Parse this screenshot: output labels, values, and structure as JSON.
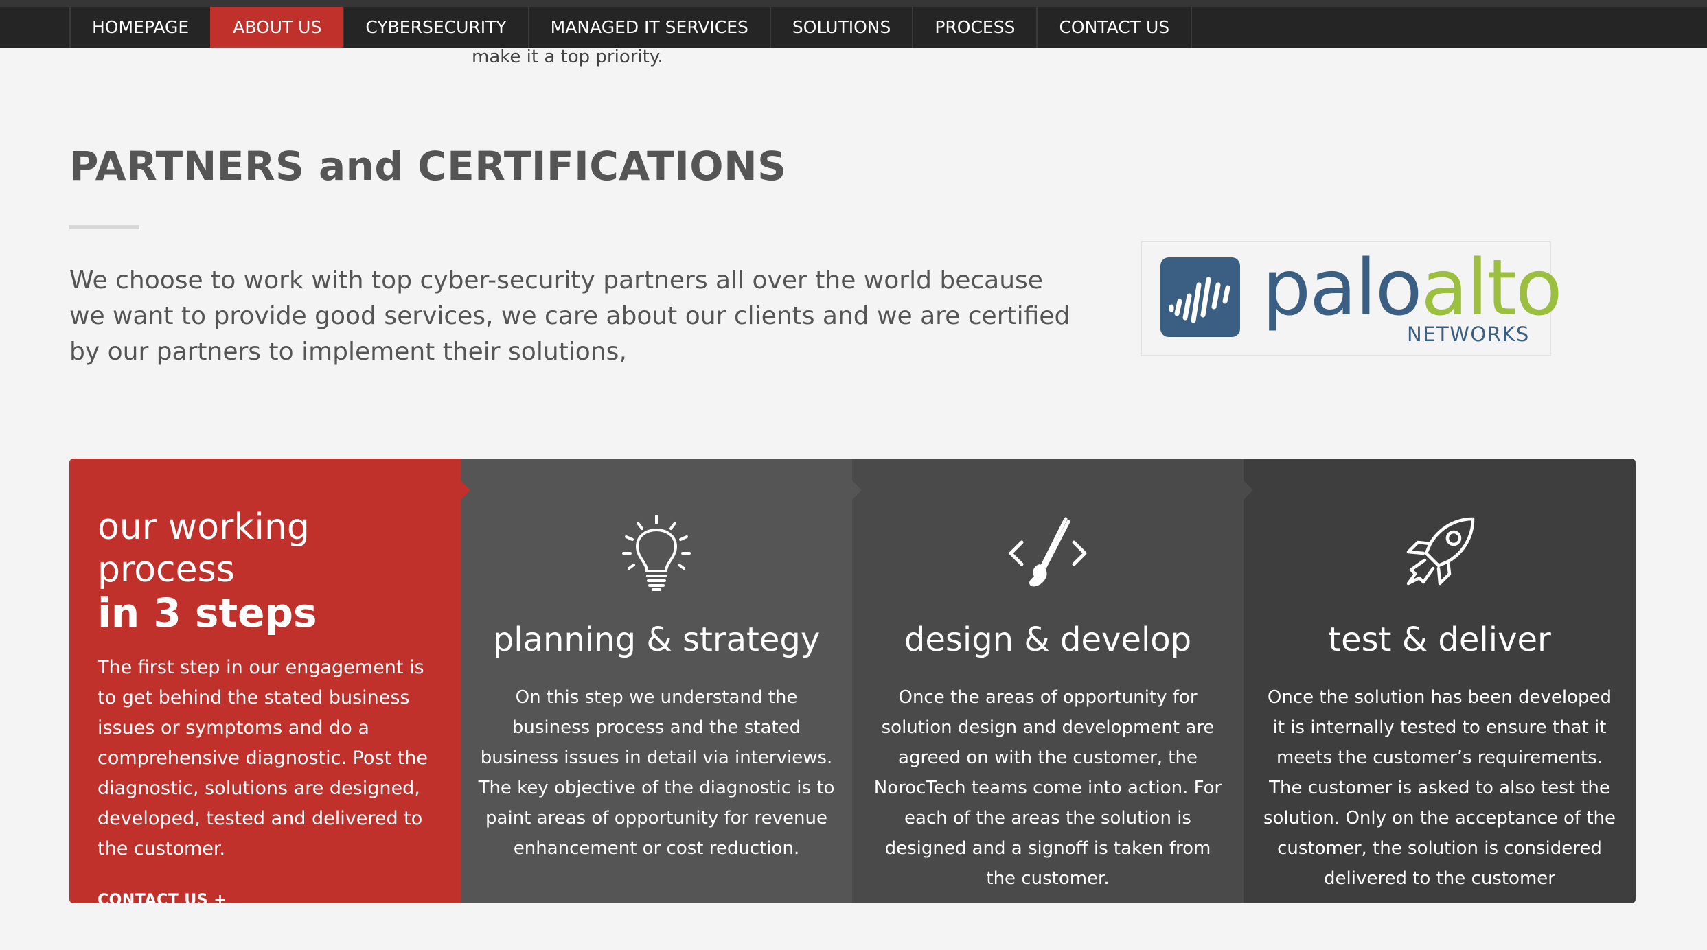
{
  "nav": {
    "items": [
      {
        "label": "HOMEPAGE"
      },
      {
        "label": "ABOUT US"
      },
      {
        "label": "CYBERSECURITY"
      },
      {
        "label": "MANAGED IT SERVICES"
      },
      {
        "label": "SOLUTIONS"
      },
      {
        "label": "PROCESS"
      },
      {
        "label": "CONTACT US"
      }
    ],
    "active": "ABOUT US"
  },
  "previous_section": {
    "tail_text": "make it a top priority."
  },
  "partners": {
    "title": "PARTNERS and CERTIFICATIONS",
    "text": "We choose to work with top cyber-security partners all over the world because we want to provide good services, we care about our clients and we are certified by our partners to implement their solutions,",
    "logo": {
      "word_first": "palo",
      "word_second": "alto",
      "subtitle": "NETWORKS",
      "colors": {
        "blue": "#3b5f82",
        "green": "#9bbf3e"
      }
    }
  },
  "process": {
    "intro": {
      "heading_light": "our working process",
      "heading_bold": "in 3 steps",
      "text": "The first step in our engagement is to get behind the stated business issues or symptoms and do a comprehensive diagnostic. Post the diagnostic, solutions are designed, developed, tested and delivered to the customer.",
      "link": "CONTACT US +"
    },
    "steps": [
      {
        "icon": "lightbulb-icon",
        "title": "planning & strategy",
        "text": "On this step we understand the business process and the stated business issues in detail via interviews. The key objective of the diagnostic is to paint areas of opportunity for revenue enhancement or cost reduction."
      },
      {
        "icon": "code-brush-icon",
        "title": "design & develop",
        "text": "Once the areas of opportunity for solution design and development are agreed on with the customer, the NorocTech teams come into action. For each of the areas the solution is designed and a signoff is taken from the customer."
      },
      {
        "icon": "rocket-icon",
        "title": "test & deliver",
        "text": "Once the solution has been developed it is internally tested to ensure that it meets the customer’s requirements. The customer is asked to also test the solution. Only on the acceptance of the customer, the solution is considered delivered to the customer"
      }
    ]
  },
  "colors": {
    "accent_red": "#c0312c",
    "nav_bg": "#252525",
    "page_bg": "#f4f4f4"
  }
}
